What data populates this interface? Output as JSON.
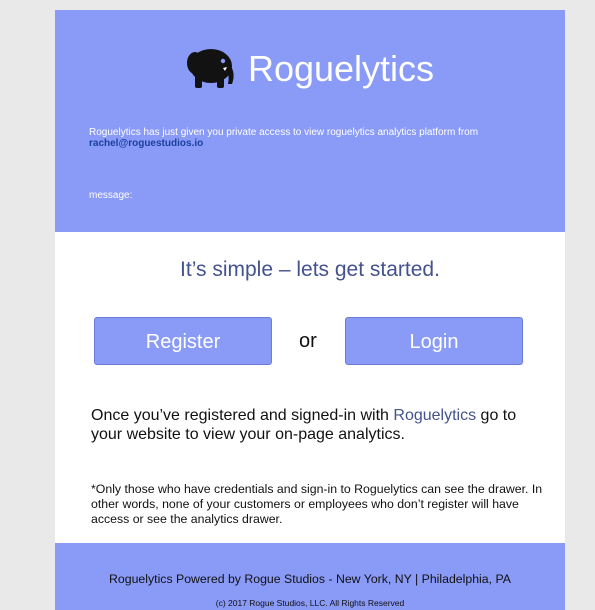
{
  "header": {
    "brand": "Roguelytics",
    "access_text": "Roguelytics has just given you private access to view roguelytics analytics platform from",
    "sender_email": "rachel@roguestudios.io",
    "message_label": "message:"
  },
  "main": {
    "headline": "It’s simple – lets get started.",
    "register_label": "Register",
    "or_text": "or",
    "login_label": "Login",
    "info_before": "Once you’ve registered and signed-in with ",
    "info_brand": "Roguelytics",
    "info_after": " go to your website to view your on-page analytics.",
    "note": "*Only those who have credentials and sign-in to Roguelytics can see the drawer. In other words, none of your customers or employees who don’t register will have access or see the analytics drawer."
  },
  "footer": {
    "powered_by": "Roguelytics Powered by Rogue Studios - New York, NY | Philadelphia, PA",
    "copyright": "(c) 2017 Rogue Studios, LLC. All Rights Reserved"
  },
  "colors": {
    "accent": "#8a9af7",
    "headline": "#44528d",
    "link": "#1c3f9e"
  },
  "icons": {
    "logo": "elephant-icon"
  }
}
